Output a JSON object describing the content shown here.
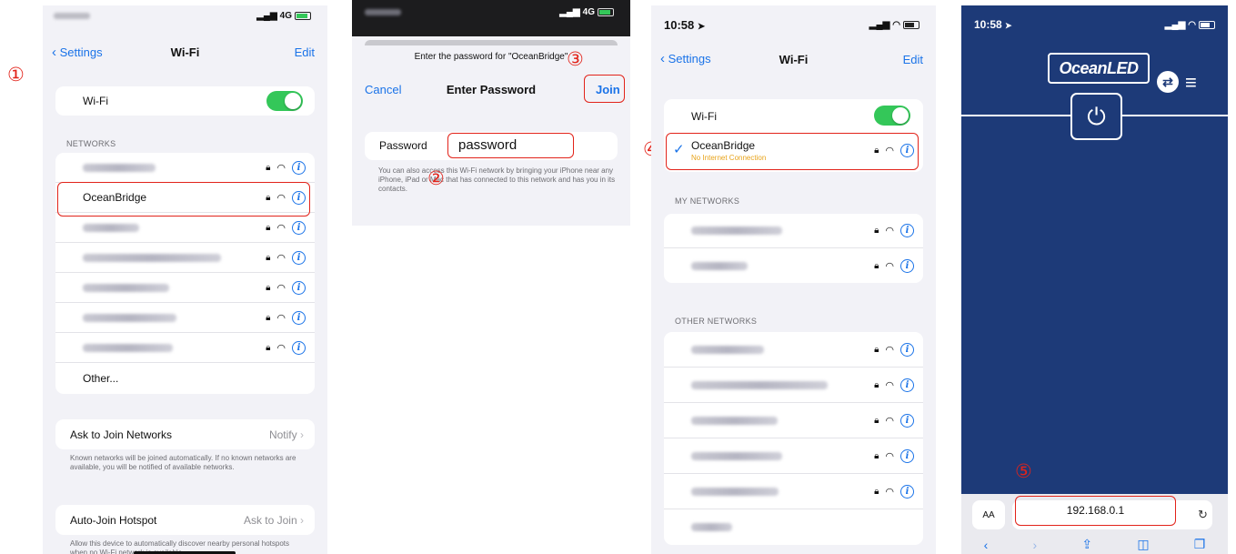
{
  "step_markers": [
    "①",
    "②",
    "③",
    "④",
    "⑤"
  ],
  "panel1": {
    "status_right": "4G",
    "nav": {
      "back": "Settings",
      "title": "Wi-Fi",
      "edit": "Edit"
    },
    "wifi_label": "Wi-Fi",
    "networks_header": "NETWORKS",
    "networks": [
      {
        "name": "",
        "blurred": true
      },
      {
        "name": "OceanBridge",
        "blurred": false
      },
      {
        "name": "",
        "blurred": true
      },
      {
        "name": "",
        "blurred": true
      },
      {
        "name": "",
        "blurred": true
      },
      {
        "name": "",
        "blurred": true
      },
      {
        "name": "",
        "blurred": true
      }
    ],
    "other": "Other...",
    "ask_join": {
      "label": "Ask to Join Networks",
      "value": "Notify"
    },
    "ask_join_note": "Known networks will be joined automatically. If no known networks are available, you will be notified of available networks.",
    "auto_join": {
      "label": "Auto-Join Hotspot",
      "value": "Ask to Join"
    },
    "auto_join_note": "Allow this device to automatically discover nearby personal hotspots when no Wi-Fi network is available."
  },
  "panel2": {
    "status_right": "4G",
    "prompt": "Enter the password for \"OceanBridge\"",
    "cancel": "Cancel",
    "title": "Enter Password",
    "join": "Join",
    "password_label": "Password",
    "password_value": "password",
    "note": "You can also access this Wi-Fi network by bringing your iPhone near any iPhone, iPad or Mac that has connected to this network and has you in its contacts."
  },
  "panel3": {
    "time": "10:58",
    "nav": {
      "back": "Settings",
      "title": "Wi-Fi",
      "edit": "Edit"
    },
    "wifi_label": "Wi-Fi",
    "connected_name": "OceanBridge",
    "connected_status": "No Internet Connection",
    "my_networks_header": "MY NETWORKS",
    "other_networks_header": "OTHER NETWORKS",
    "my_networks_count_rows": [
      "",
      ""
    ],
    "other_networks_rows": [
      "",
      "",
      "",
      "",
      "",
      ""
    ]
  },
  "panel4": {
    "time": "10:58",
    "logo": "OceanLED",
    "url": "192.168.0.1",
    "text_size": "AA"
  },
  "colors": {
    "ios_blue": "#1a73e8",
    "toggle_green": "#34c759",
    "marker_red": "#e2231a",
    "ocean_navy": "#1d3a78",
    "warn_orange": "#e8a31a"
  }
}
